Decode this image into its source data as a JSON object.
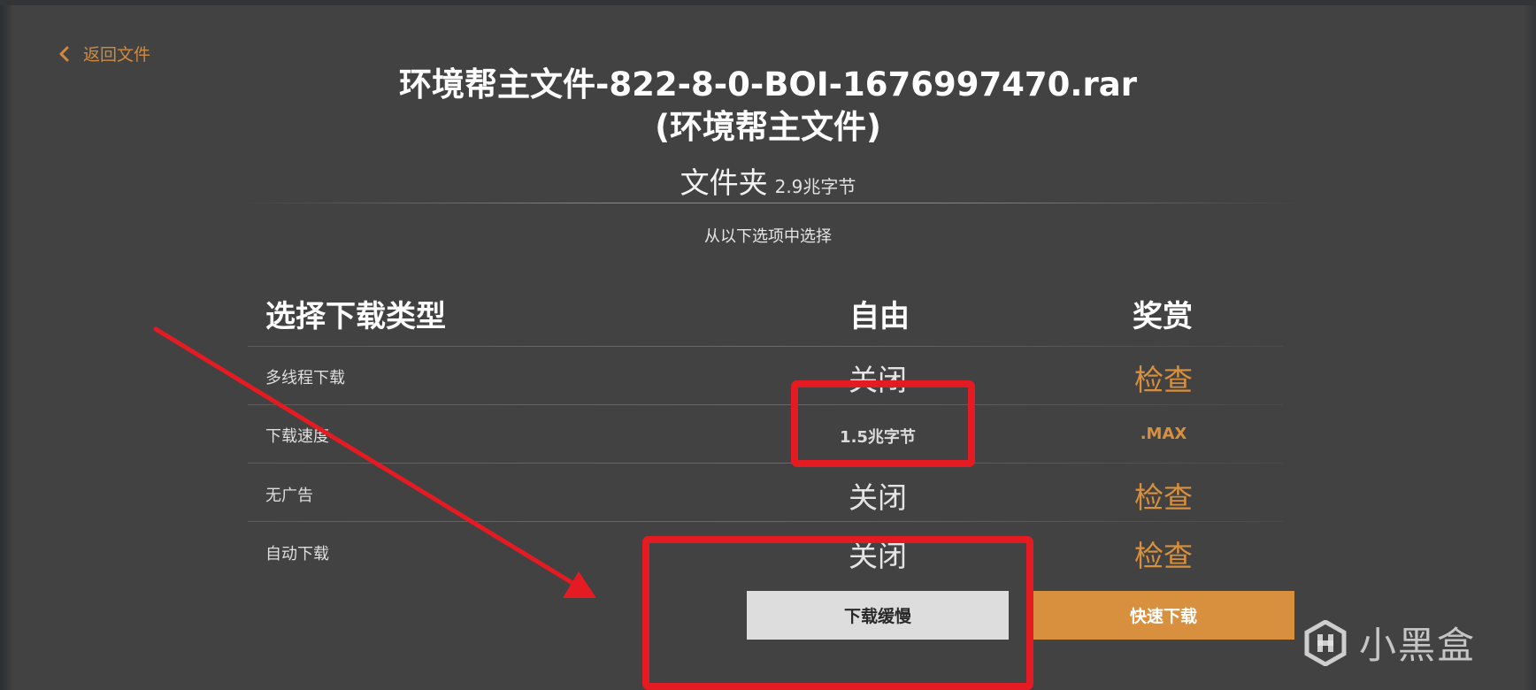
{
  "back": {
    "label": "返回文件"
  },
  "file": {
    "name": "环境帮主文件-822-8-0-BOI-1676997470.rar",
    "owner": "(环境帮主文件)",
    "kind": "文件夹",
    "size": "2.9兆字节"
  },
  "prompt": "从以下选项中选择",
  "table": {
    "headers": {
      "type": "选择下载类型",
      "free": "自由",
      "reward": "奖赏"
    },
    "rows": [
      {
        "label": "多线程下载",
        "free": "关闭",
        "reward": "检查"
      },
      {
        "label": "下载速度",
        "free": "1.5兆字节",
        "reward": ".MAX"
      },
      {
        "label": "无广告",
        "free": "关闭",
        "reward": "检查"
      },
      {
        "label": "自动下载",
        "free": "关闭",
        "reward": "检查"
      }
    ]
  },
  "buttons": {
    "slow": "下载缓慢",
    "fast": "快速下载"
  },
  "watermark": {
    "text": "小黑盒"
  },
  "colors": {
    "accent": "#d8903f",
    "background": "#424242",
    "annotation_red": "#e41b23"
  },
  "icons": {
    "back": "chevron-left-icon",
    "watermark": "heybox-logo-icon"
  }
}
